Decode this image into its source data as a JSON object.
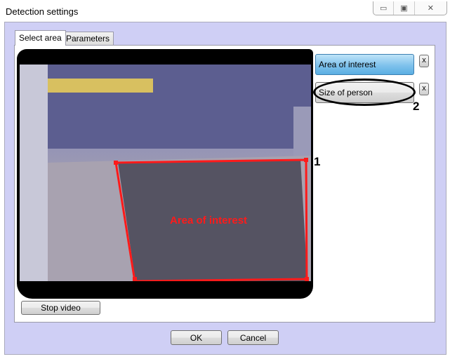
{
  "window": {
    "title": "Detection settings",
    "minimize": "▭",
    "maximize": "▣",
    "close": "✕"
  },
  "tabs": [
    {
      "label": "Select area"
    },
    {
      "label": "Parameters"
    }
  ],
  "areas": [
    {
      "label": "Area of interest",
      "delete": "x"
    },
    {
      "label": "Size of person",
      "delete": "x"
    }
  ],
  "video": {
    "overlay_label": "Area of interest",
    "stop_label": "Stop video"
  },
  "callouts": [
    "1",
    "2"
  ],
  "footer": {
    "ok": "OK",
    "cancel": "Cancel"
  },
  "colors": {
    "zone": "#ff1a1a",
    "selected": "#7fc2ec",
    "frame": "#cfcff5"
  }
}
